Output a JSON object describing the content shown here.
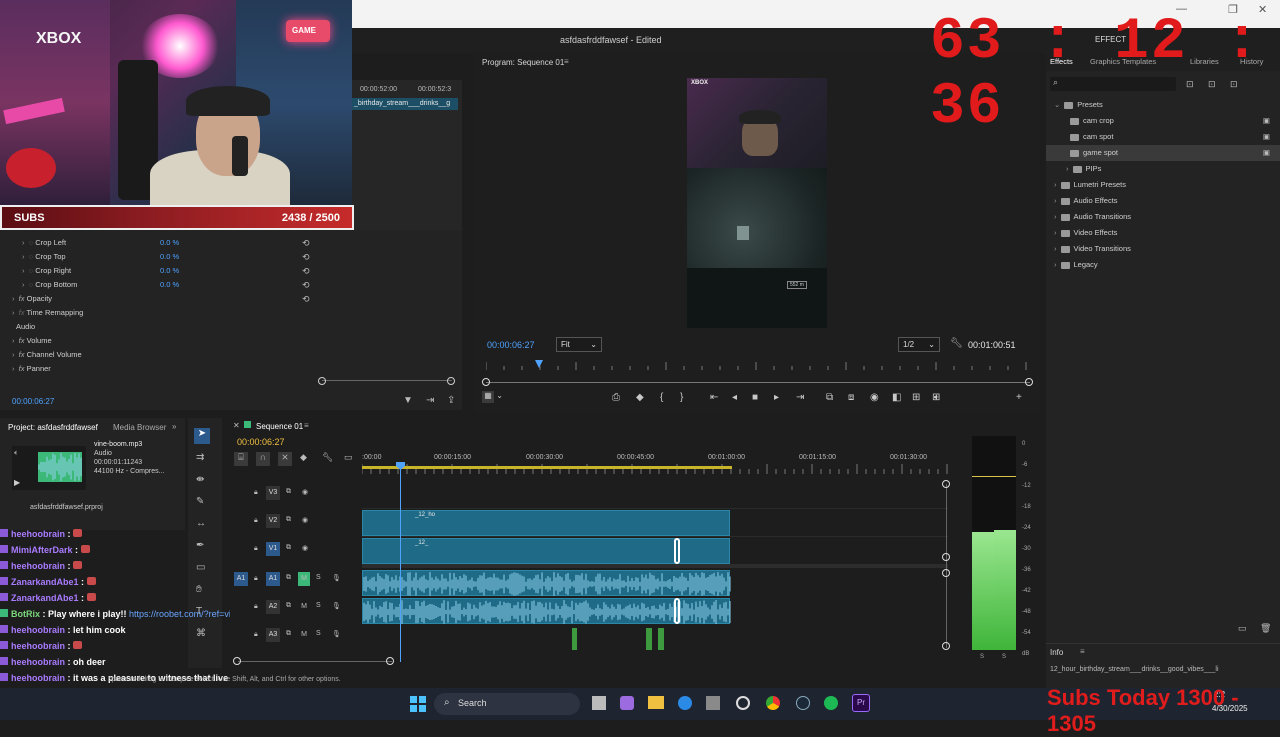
{
  "app": {
    "title": "asfdasfrddfawsef - Edited",
    "menu_right": "EFFECT"
  },
  "overlay": {
    "timer": "63 : 12 : 36",
    "subs_label": "SUBS",
    "subs_count": "2438 / 2500",
    "subs_today": "Subs Today 1300 - 1305",
    "webcam_sign_xbox": "XBOX",
    "webcam_sign_right": "GAME"
  },
  "source": {
    "tc_left": "00:00:52:00",
    "tc_right": "00:00:52:3",
    "clip_name": "_birthday_stream___drinks__g"
  },
  "effect_controls": {
    "rows": [
      {
        "label": "Crop Left",
        "value": "0.0 %"
      },
      {
        "label": "Crop Top",
        "value": "0.0 %"
      },
      {
        "label": "Crop Right",
        "value": "0.0 %"
      },
      {
        "label": "Crop Bottom",
        "value": "0.0 %"
      }
    ],
    "opacity": "Opacity",
    "time_remap": "Time Remapping",
    "audio_section": "Audio",
    "volume": "Volume",
    "channel_volume": "Channel Volume",
    "panner": "Panner",
    "timecode": "00:00:06:27"
  },
  "program": {
    "title": "Program: Sequence 01",
    "timecode": "00:00:06:27",
    "fit": "Fit",
    "resolution": "1/2",
    "duration": "00:01:00:51",
    "overlay_tag": "XBOX",
    "distance": "552 m"
  },
  "effects_panel": {
    "tabs": [
      "Effects",
      "Graphics Templates",
      "Libraries",
      "History"
    ],
    "tree": [
      {
        "label": "Presets",
        "level": 0,
        "open": true
      },
      {
        "label": "cam crop",
        "level": 1
      },
      {
        "label": "cam spot",
        "level": 1
      },
      {
        "label": "game spot",
        "level": 1,
        "selected": true
      },
      {
        "label": "PIPs",
        "level": 1,
        "folder": true
      },
      {
        "label": "Lumetri Presets",
        "level": 0
      },
      {
        "label": "Audio Effects",
        "level": 0
      },
      {
        "label": "Audio Transitions",
        "level": 0
      },
      {
        "label": "Video Effects",
        "level": 0
      },
      {
        "label": "Video Transitions",
        "level": 0
      },
      {
        "label": "Legacy",
        "level": 0
      }
    ],
    "info_title": "Info",
    "info_text": "12_hour_birthday_stream___drinks__good_vibes___li"
  },
  "project": {
    "title": "Project: asfdasfrddfawsef",
    "media_browser": "Media Browser",
    "clip_name": "vine-boom.mp3",
    "clip_type": "Audio",
    "clip_tc": "00:00:01:11243",
    "clip_info": "44100 Hz - Compres...",
    "file": "asfdasfrddfawsef.prproj"
  },
  "timeline": {
    "title": "Sequence 01",
    "timecode": "00:00:06:27",
    "ruler": [
      ":00:00",
      "00:00:15:00",
      "00:00:30:00",
      "00:00:45:00",
      "00:01:00:00",
      "00:01:15:00",
      "00:01:30:00"
    ],
    "tracks": [
      "V3",
      "V2",
      "V1",
      "A1",
      "A2",
      "A3"
    ],
    "clip_label_1": "_12_ho",
    "clip_label_2": "_12_",
    "mixer_labels": [
      "M",
      "S"
    ]
  },
  "meters": {
    "scale": [
      "0",
      "-6",
      "-12",
      "-18",
      "-24",
      "-30",
      "-36",
      "-42",
      "-48",
      "-54",
      "dB"
    ],
    "bottom_labels": [
      "S",
      "S"
    ],
    "level_left": 0.55,
    "level_right": 0.56
  },
  "chat": [
    {
      "name": "heehoobrain",
      "msg": "",
      "color": "purple"
    },
    {
      "name": "MimiAfterDark",
      "msg": "",
      "color": "purple"
    },
    {
      "name": "heehoobrain",
      "msg": "",
      "color": "purple"
    },
    {
      "name": "ZanarkandAbe1",
      "msg": "",
      "color": "purple"
    },
    {
      "name": "ZanarkandAbe1",
      "msg": "",
      "color": "purple"
    },
    {
      "name": "BotRix",
      "msg": "Play where i play!! ",
      "link": "https://roobet.com/?ref=viv",
      "color": "green"
    },
    {
      "name": "heehoobrain",
      "msg": "let him cook",
      "color": "purple"
    },
    {
      "name": "heehoobrain",
      "msg": "",
      "color": "purple"
    },
    {
      "name": "heehoobrain",
      "msg": "oh deer",
      "color": "purple"
    },
    {
      "name": "heehoobrain",
      "msg": "it was a pleasure to witness that live LOL",
      "color": "purple"
    },
    {
      "name": "MimiAfterDark",
      "msg": "",
      "color": "purple"
    }
  ],
  "status_bar": "space and drag to marquee select. Use Shift, Alt, and Ctrl for other options.",
  "taskbar": {
    "search_label": "Search",
    "date": "4/30/2025",
    "time": "2:2"
  }
}
